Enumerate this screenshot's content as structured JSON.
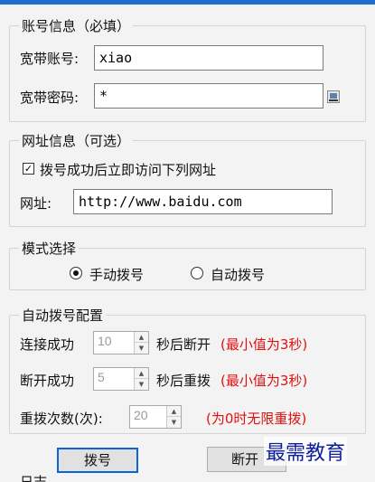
{
  "account": {
    "legend": "账号信息（必填）",
    "username_label": "宽带账号:",
    "username_value": "xiao",
    "password_label": "宽带密码:",
    "password_value": "*"
  },
  "url_section": {
    "legend": "网址信息（可选）",
    "checkbox_label": "拨号成功后立即访问下列网址",
    "checkbox_checked": true,
    "url_label": "网址:",
    "url_value": "http://www.baidu.com"
  },
  "mode": {
    "legend": "模式选择",
    "options": [
      "手动拨号",
      "自动拨号"
    ],
    "selected": "手动拨号"
  },
  "auto_dial": {
    "legend": "自动拨号配置",
    "rows": [
      {
        "label": "连接成功",
        "value": "10",
        "suffix": "秒后断开",
        "hint": "(最小值为3秒)"
      },
      {
        "label": "断开成功",
        "value": "5",
        "suffix": "秒后重拨",
        "hint": "(最小值为3秒)"
      },
      {
        "label": "重拨次数(次):",
        "value": "20",
        "hint": "(为0时无限重拨)"
      }
    ]
  },
  "buttons": {
    "dial": "拨号",
    "disconnect": "断开"
  },
  "partial_label": "日志",
  "watermark": "最需教育",
  "colors": {
    "hint_red": "#e01010",
    "primary_border": "#0a64d6",
    "watermark_blue": "#0f1f99"
  }
}
